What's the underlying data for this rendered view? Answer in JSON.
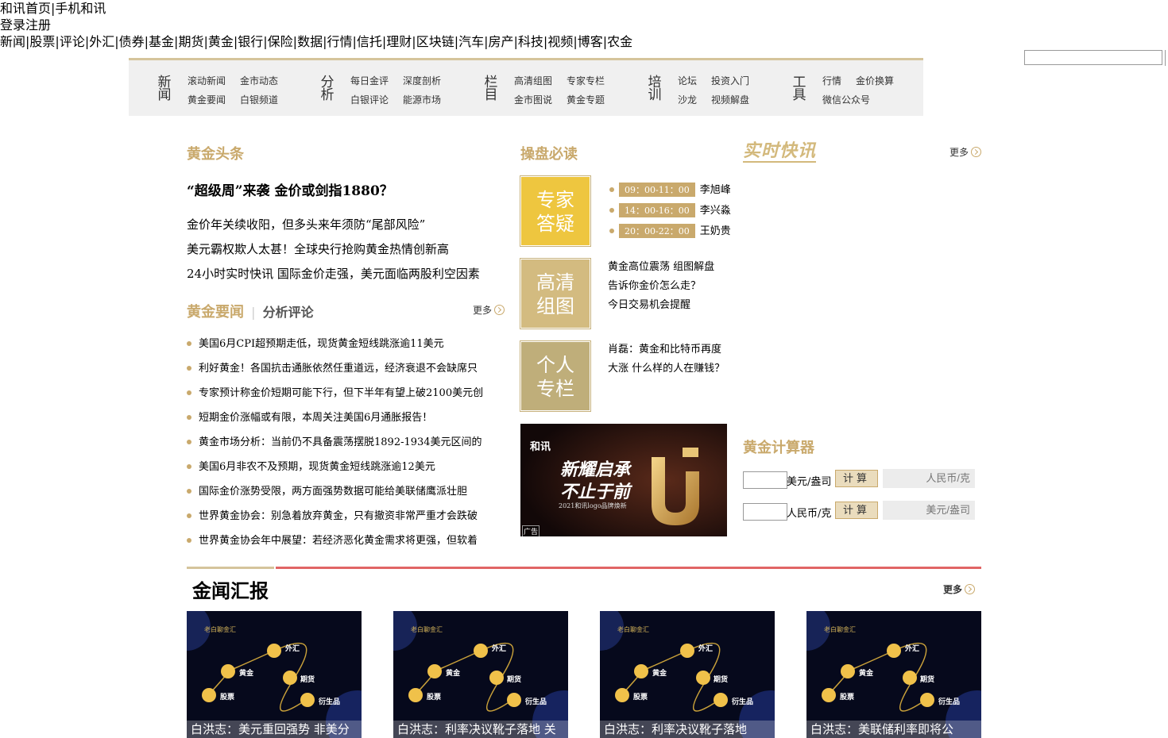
{
  "top": {
    "home_link": "和讯首页",
    "mobile_link": "手机和讯",
    "pipe": "|",
    "login": "登录",
    "register": "注册"
  },
  "nav": [
    "新闻",
    "股票",
    "评论",
    "外汇",
    "债券",
    "基金",
    "期货",
    "黄金",
    "银行",
    "保险",
    "数据",
    "行情",
    "信托",
    "理财",
    "区块链",
    "汽车",
    "房产",
    "科技",
    "视频",
    "博客",
    "农金"
  ],
  "search": {
    "value": ""
  },
  "channels": [
    {
      "title": "新闻",
      "links": [
        "滚动新闻",
        "金市动态",
        "黄金要闻",
        "白银频道"
      ]
    },
    {
      "title": "分析",
      "links": [
        "每日金评",
        "深度剖析",
        "白银评论",
        "能源市场"
      ]
    },
    {
      "title": "栏目",
      "links": [
        "高清组图",
        "专家专栏",
        "金市图说",
        "黄金专题"
      ]
    },
    {
      "title": "培训",
      "links": [
        "论坛",
        "投资入门",
        "沙龙",
        "视频解盘"
      ]
    },
    {
      "title": "工具",
      "links": [
        "行情",
        "金价换算",
        "微信公众号"
      ]
    }
  ],
  "headlines": {
    "title": "黄金头条",
    "main": "“超级周”来袭 金价或剑指1880？",
    "items": [
      "金价年关续收阳，但多头来年须防“尾部风险”",
      "美元霸权欺人太甚！全球央行抢购黄金热情创新高",
      "24小时实时快讯 国际金价走强，美元面临两股利空因素"
    ]
  },
  "news": {
    "tab_active": "黄金要闻",
    "tab_other": "分析评论",
    "tab_sep": "|",
    "more": "更多",
    "items": [
      "美国6月CPI超预期走低，现货黄金短线跳涨逾11美元",
      "利好黄金！各国抗击通胀依然任重道远，经济衰退不会缺席只",
      "专家预计称金价短期可能下行，但下半年有望上破2100美元创",
      "短期金价涨幅或有限，本周关注美国6月通胀报告！",
      "黄金市场分析：当前仍不具备震荡摆脱1892-1934美元区间的",
      "美国6月非农不及预期，现货黄金短线跳涨逾12美元",
      "国际金价涨势受限，两方面强势数据可能给美联储鹰派壮胆",
      "世界黄金协会：别急着放弃黄金，只有撤资非常严重才会跌破",
      "世界黄金协会年中展望：若经济恶化黄金需求将更强，但软着"
    ]
  },
  "must_read": {
    "title": "操盘必读",
    "tiles": [
      {
        "label1": "专家",
        "label2": "答疑",
        "color": "#eec63f"
      },
      {
        "label1": "高清",
        "label2": "组图",
        "color": "#d3bb80"
      },
      {
        "label1": "个人",
        "label2": "专栏",
        "color": "#bfae7a"
      }
    ],
    "schedule": [
      {
        "time": "09：00-11：00",
        "name": "李旭峰"
      },
      {
        "time": "14：00-16：00",
        "name": "李兴淼"
      },
      {
        "time": "20：00-22：00",
        "name": "王奶贵"
      }
    ],
    "photo_links": [
      "黄金高位震荡 组图解盘",
      "告诉你金价怎么走？",
      "今日交易机会提醒"
    ],
    "column_text": "肖磊：黄金和比特币再度大涨 什么样的人在赚钱？"
  },
  "ad": {
    "brand": "和讯",
    "line1": "新耀启承",
    "line2": "不止于前",
    "sub": "2021和讯logo品牌焕新",
    "tag": "广告"
  },
  "flash": {
    "title": "实时快讯",
    "more": "更多"
  },
  "calculator": {
    "title": "黄金计算器",
    "rows": [
      {
        "value": "",
        "unit": "美元/盎司",
        "button": "计算",
        "result_placeholder": "人民币/克"
      },
      {
        "value": "",
        "unit": "人民币/克",
        "button": "计算",
        "result_placeholder": "美元/盎司"
      }
    ]
  },
  "report": {
    "title": "金闻汇报",
    "more": "更多",
    "cards": [
      {
        "caption": "白洪志：美元重回强势 非美分",
        "brand": "老白聊金汇"
      },
      {
        "caption": "白洪志：利率决议靴子落地 关",
        "brand": "老白聊金汇"
      },
      {
        "caption": "白洪志：利率决议靴子落地 ",
        "brand": "老白聊金汇"
      },
      {
        "caption": "白洪志：美联储利率即将公",
        "brand": "老白聊金汇"
      }
    ],
    "diagram_labels": {
      "forex": "外汇",
      "gold": "黄金",
      "futures": "期货",
      "stocks": "股票",
      "derivatives": "衍生品"
    }
  }
}
